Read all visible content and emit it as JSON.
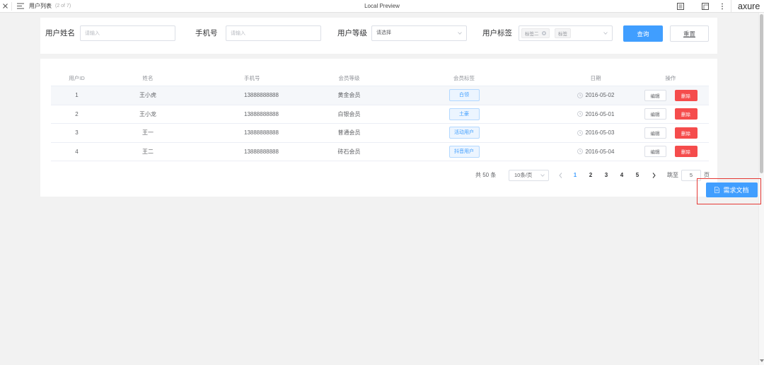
{
  "topbar": {
    "page_title": "用户列表",
    "page_counter": "(2 of 7)",
    "center_title": "Local Preview",
    "brand": "axure",
    "icons": [
      "close-icon",
      "hamburger-icon",
      "notes-icon",
      "adaptive-view-icon",
      "more-icon"
    ]
  },
  "filters": {
    "name": {
      "label": "用户姓名",
      "placeholder": "请输入"
    },
    "phone": {
      "label": "手机号",
      "placeholder": "请输入"
    },
    "level": {
      "label": "用户等级",
      "placeholder": "请选择"
    },
    "tags": {
      "label": "用户标签",
      "selected": [
        "标签二",
        "标签"
      ]
    },
    "search_label": "查询",
    "reset_label": "重置"
  },
  "table": {
    "columns": [
      "用户ID",
      "姓名",
      "手机号",
      "会员等级",
      "会员标签",
      "日期",
      "操作"
    ],
    "rows": [
      {
        "id": "1",
        "name": "王小虎",
        "phone": "13888888888",
        "level": "黄金会员",
        "tag": "白领",
        "date": "2016-05-02"
      },
      {
        "id": "2",
        "name": "王小龙",
        "phone": "13888888888",
        "level": "白银会员",
        "tag": "土豪",
        "date": "2016-05-01"
      },
      {
        "id": "3",
        "name": "王一",
        "phone": "13888888888",
        "level": "普通会员",
        "tag": "活动用户",
        "date": "2016-05-03"
      },
      {
        "id": "4",
        "name": "王二",
        "phone": "13888888888",
        "level": "砖石会员",
        "tag": "抖音用户",
        "date": "2016-05-04"
      }
    ],
    "actions": {
      "edit": "编辑",
      "delete": "删除"
    }
  },
  "pagination": {
    "total": "共 50 条",
    "page_size": "10条/页",
    "pages": [
      "1",
      "2",
      "3",
      "4",
      "5"
    ],
    "current_page": 1,
    "jump_label": "跳至",
    "jump_value": "5",
    "page_unit": "页"
  },
  "doc_button": {
    "label": "需求文档",
    "icon": "document-icon"
  },
  "theme": {
    "primary": "#409eff",
    "danger": "#f54c4c",
    "highlight_outline": "#e53935",
    "page_background": "#f2f2f2"
  }
}
